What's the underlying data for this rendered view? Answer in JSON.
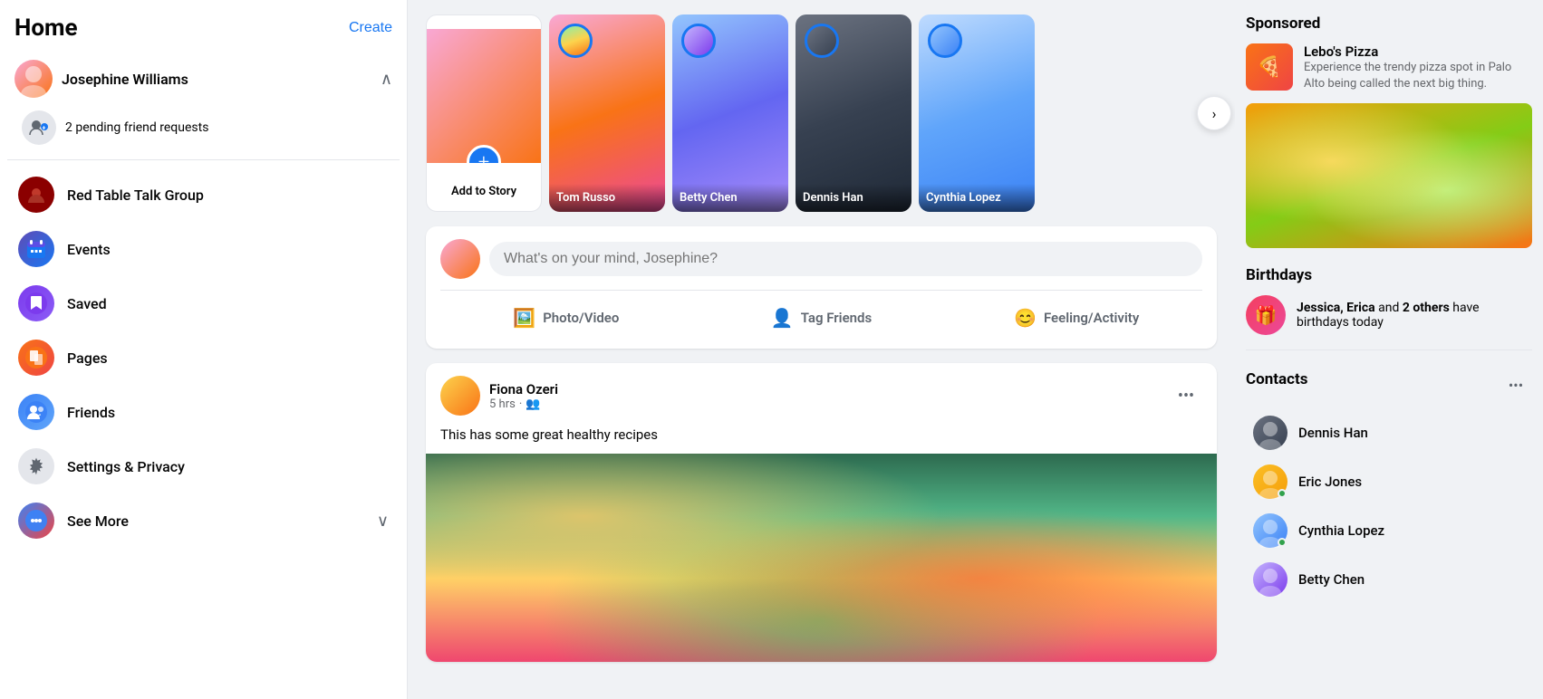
{
  "sidebar": {
    "title": "Home",
    "create_label": "Create",
    "user": {
      "name": "Josephine Williams",
      "pending_requests": "2 pending friend requests"
    },
    "items": [
      {
        "id": "red-table",
        "label": "Red Table Talk Group",
        "icon": "🔴"
      },
      {
        "id": "events",
        "label": "Events",
        "icon": "📅"
      },
      {
        "id": "saved",
        "label": "Saved",
        "icon": "🔖"
      },
      {
        "id": "pages",
        "label": "Pages",
        "icon": "🏳️"
      },
      {
        "id": "friends",
        "label": "Friends",
        "icon": "👥"
      },
      {
        "id": "settings",
        "label": "Settings & Privacy",
        "icon": "⚙️"
      },
      {
        "id": "see-more",
        "label": "See More",
        "icon": "⊕"
      }
    ]
  },
  "stories": {
    "add_label": "Add to Story",
    "items": [
      {
        "name": "Tom Russo"
      },
      {
        "name": "Betty Chen"
      },
      {
        "name": "Dennis Han"
      },
      {
        "name": "Cynthia Lopez"
      }
    ]
  },
  "post_box": {
    "placeholder": "What's on your mind, Josephine?",
    "actions": [
      {
        "id": "photo",
        "label": "Photo/Video",
        "icon": "🖼️"
      },
      {
        "id": "tag",
        "label": "Tag Friends",
        "icon": "👤"
      },
      {
        "id": "feeling",
        "label": "Feeling/Activity",
        "icon": "😊"
      }
    ]
  },
  "feed": {
    "posts": [
      {
        "id": "post1",
        "author": "Fiona Ozeri",
        "time": "5 hrs",
        "audience": "👥",
        "text": "This has some great healthy recipes",
        "has_image": true
      }
    ]
  },
  "right_panel": {
    "sponsored": {
      "title": "Sponsored",
      "advertiser": "Lebo's Pizza",
      "advertiser_icon": "🍕",
      "description": "Experience the trendy pizza spot in Palo Alto being called the next big thing.",
      "has_image": true
    },
    "birthdays": {
      "title": "Birthdays",
      "text_pre": "Jessica, Erica",
      "text_bold": " and ",
      "text_count": "2 others",
      "text_post": " have birthdays today"
    },
    "contacts": {
      "title": "Contacts",
      "items": [
        {
          "name": "Dennis Han",
          "online": false,
          "av_class": "av-dennis"
        },
        {
          "name": "Eric Jones",
          "online": true,
          "av_class": "av-eric"
        },
        {
          "name": "Cynthia Lopez",
          "online": true,
          "av_class": "av-cynthia"
        },
        {
          "name": "Betty Chen",
          "online": false,
          "av_class": "av-betty"
        }
      ]
    }
  }
}
